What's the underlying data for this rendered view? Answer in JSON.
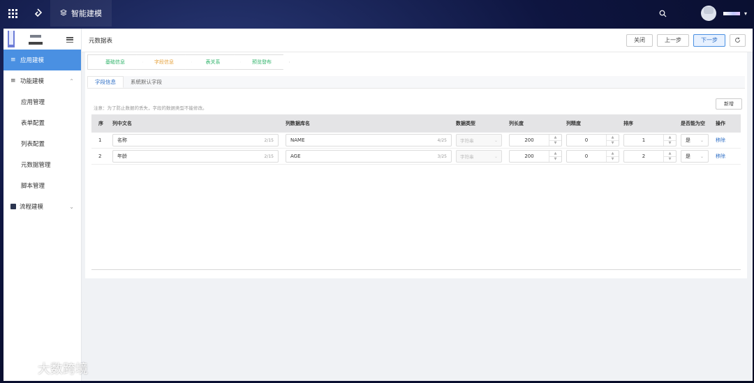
{
  "topbar": {
    "app_tab_label": "智能建模"
  },
  "sidebar": {
    "items": [
      {
        "label": "应用建模",
        "active": true
      },
      {
        "label": "功能建模"
      }
    ],
    "subitems": [
      "应用管理",
      "表单配置",
      "列表配置",
      "元数据管理",
      "脚本管理"
    ],
    "flow_label": "流程建模"
  },
  "header": {
    "title": "元数据表",
    "buttons": {
      "close": "关闭",
      "prev": "上一步",
      "next": "下一步"
    }
  },
  "steps": [
    "基础信息",
    "字段信息",
    "表关系",
    "预览發布"
  ],
  "tabs": [
    "字段信息",
    "系統默认字段"
  ],
  "note": "注意：为了防止数据的丢失，字段的数据类型不能修改。",
  "add_label": "新增",
  "table": {
    "headers": [
      "序",
      "列中文名",
      "列数据库名",
      "数据类型",
      "列长度",
      "列精度",
      "排序",
      "是否能为空",
      "操作"
    ],
    "rows": [
      {
        "idx": "1",
        "cn": "名称",
        "cn_count": "2/15",
        "db": "NAME",
        "db_count": "4/25",
        "type": "字符串",
        "len": "200",
        "prec": "0",
        "sort": "1",
        "nullable": "是",
        "op": "移除"
      },
      {
        "idx": "2",
        "cn": "年龄",
        "cn_count": "2/15",
        "db": "AGE",
        "db_count": "3/25",
        "type": "字符串",
        "len": "200",
        "prec": "0",
        "sort": "2",
        "nullable": "是",
        "op": "移除"
      }
    ]
  },
  "watermark": "大数跨境",
  "colors": {
    "primary": "#4a90e2",
    "step_done": "#2fb36a",
    "step_current": "#e6a23c"
  }
}
